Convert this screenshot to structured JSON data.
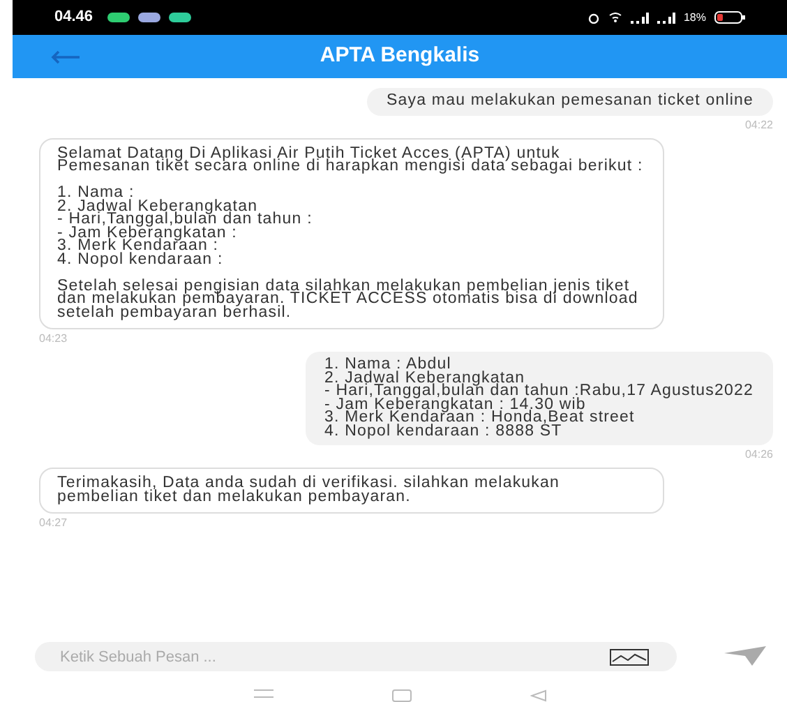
{
  "status_bar": {
    "time": "04.46",
    "battery": "18%"
  },
  "app_bar": {
    "title": "APTA Bengkalis"
  },
  "messages": [
    {
      "kind": "sent",
      "text": "Saya mau melakukan pemesanan ticket online",
      "time": "04:22"
    },
    {
      "kind": "received",
      "text": "Selamat Datang Di Aplikasi Air Putih Ticket Acces (APTA) untuk Pemesanan tiket secara online di harapkan mengisi data sebagai berikut :\n\n1. Nama :\n2. Jadwal Keberangkatan\n- Hari,Tanggal,bulan dan tahun :\n- Jam Keberangkatan :\n3. Merk Kendaraan :\n4. Nopol kendaraan :\n\nSetelah selesai pengisian data silahkan melakukan pembelian jenis tiket dan melakukan pembayaran. TICKET ACCESS otomatis bisa di download setelah pembayaran berhasil.",
      "time": "04:23"
    },
    {
      "kind": "sent",
      "text": "1. Nama : Abdul\n2. Jadwal Keberangkatan\n- Hari,Tanggal,bulan dan tahun :Rabu,17 Agustus2022\n- Jam Keberangkatan : 14.30 wib\n3. Merk Kendaraan : Honda,Beat street\n4. Nopol kendaraan : 8888 ST",
      "time": "04:26"
    },
    {
      "kind": "received",
      "text": "Terimakasih, Data anda sudah di verifikasi. silahkan melakukan pembelian tiket dan melakukan pembayaran.",
      "time": "04:27"
    }
  ],
  "composer": {
    "placeholder": "Ketik Sebuah Pesan ..."
  }
}
